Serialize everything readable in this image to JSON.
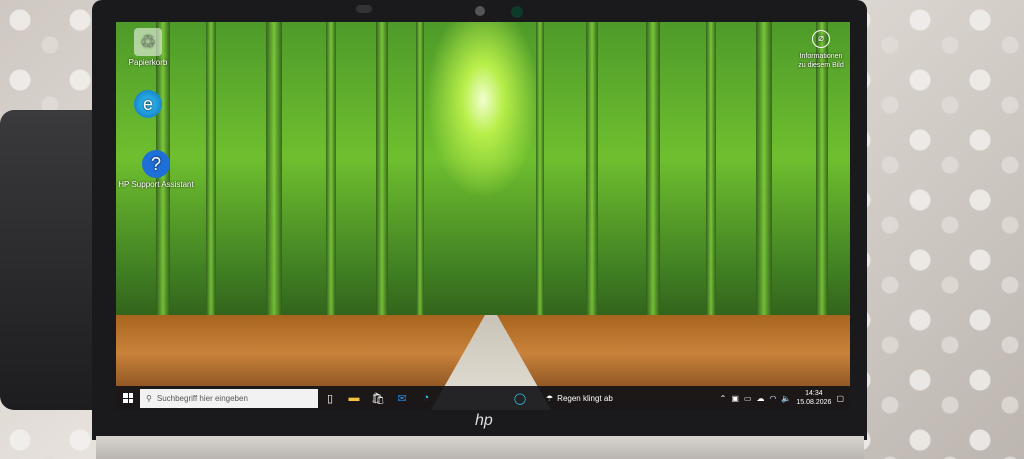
{
  "desktop": {
    "icons": [
      {
        "label": "Papierkorb",
        "icon": "recycle-bin-icon"
      },
      {
        "label": "",
        "icon": "edge-icon"
      },
      {
        "label": "HP Support Assistant",
        "icon": "help-icon"
      }
    ],
    "spotlight": {
      "label": "Informationen zu diesem Bild",
      "icon": "camera-info-icon"
    }
  },
  "taskbar": {
    "search_placeholder": "Suchbegriff hier eingeben",
    "apps": [
      "task-view-icon",
      "file-explorer-icon",
      "store-icon",
      "mail-icon",
      "edge-icon",
      "cortana-icon"
    ],
    "weather": {
      "text": "Regen klingt ab",
      "icon": "weather-icon"
    },
    "time": "14:34",
    "date": "15.08.2026"
  },
  "brand": "hp",
  "colors": {
    "taskbar": "#141418",
    "accent": "#0078d7"
  }
}
